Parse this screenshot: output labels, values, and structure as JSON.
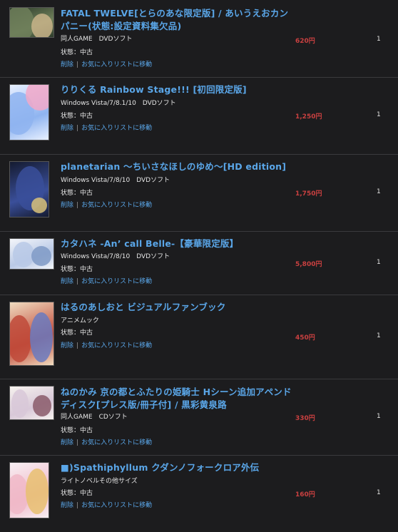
{
  "items": [
    {
      "title": "FATAL TWELVE[とらのあな限定版] / あいうえおカンパニー(状態:設定資料集欠品)",
      "meta": "同人GAME　DVDソフト",
      "condition": "状態：中古",
      "delete_label": "削除",
      "separator": "|",
      "wishlist_label": "お気に入りリストに移動",
      "price": "620円",
      "qty": "1",
      "thumb_colors": [
        "#2c3b2a",
        "#6f7f5a",
        "#c9b48a"
      ]
    },
    {
      "title": "りりくる Rainbow Stage!!! [初回限定版]",
      "meta": "Windows Vista/7/8.1/10　DVDソフト",
      "condition": "状態：中古",
      "delete_label": "削除",
      "separator": "|",
      "wishlist_label": "お気に入りリストに移動",
      "price": "1,250円",
      "qty": "1",
      "thumb_colors": [
        "#e8f0ff",
        "#8fb4f0",
        "#f2a8c8"
      ]
    },
    {
      "title": "planetarian 〜ちいさなほしのゆめ〜[HD edition]",
      "meta": "Windows Vista/7/8/10　DVDソフト",
      "condition": "状態：中古",
      "delete_label": "削除",
      "separator": "|",
      "wishlist_label": "お気に入りリストに移動",
      "price": "1,750円",
      "qty": "1",
      "thumb_colors": [
        "#141a30",
        "#3a4f9a",
        "#d9c27a"
      ]
    },
    {
      "title": "カタハネ -An’ call Belle-【豪華限定版】",
      "meta": "Windows Vista/7/8/10　DVDソフト",
      "condition": "状態：中古",
      "delete_label": "削除",
      "separator": "|",
      "wishlist_label": "お気に入りリストに移動",
      "price": "5,800円",
      "qty": "1",
      "thumb_colors": [
        "#f4f6fa",
        "#b9c9e6",
        "#7f9ac6"
      ]
    },
    {
      "title": "はるのあしおと ビジュアルファンブック",
      "meta": "アニメムック",
      "condition": "状態：中古",
      "delete_label": "削除",
      "separator": "|",
      "wishlist_label": "お気に入りリストに移動",
      "price": "450円",
      "qty": "1",
      "thumb_colors": [
        "#f0dcc0",
        "#c04a3a",
        "#6a7ac0"
      ]
    },
    {
      "title": "ねのかみ 京の都とふたりの姫騎士 Hシーン追加アペンドディスク[プレス版/冊子付] / 黒彩黄泉路",
      "meta": "同人GAME　CDソフト",
      "condition": "状態：中古",
      "delete_label": "削除",
      "separator": "|",
      "wishlist_label": "お気に入りリストに移動",
      "price": "330円",
      "qty": "1",
      "thumb_colors": [
        "#f6f2ee",
        "#d8c8d8",
        "#8a5a6a"
      ]
    },
    {
      "title": "■)Spathiphyllum クダンノフォークロア外伝",
      "meta": "ライトノベルその他サイズ",
      "condition": "状態：中古",
      "delete_label": "削除",
      "separator": "|",
      "wishlist_label": "お気に入りリストに移動",
      "price": "160円",
      "qty": "1",
      "thumb_colors": [
        "#f8f0f4",
        "#f0b8c8",
        "#e8c070"
      ]
    }
  ]
}
